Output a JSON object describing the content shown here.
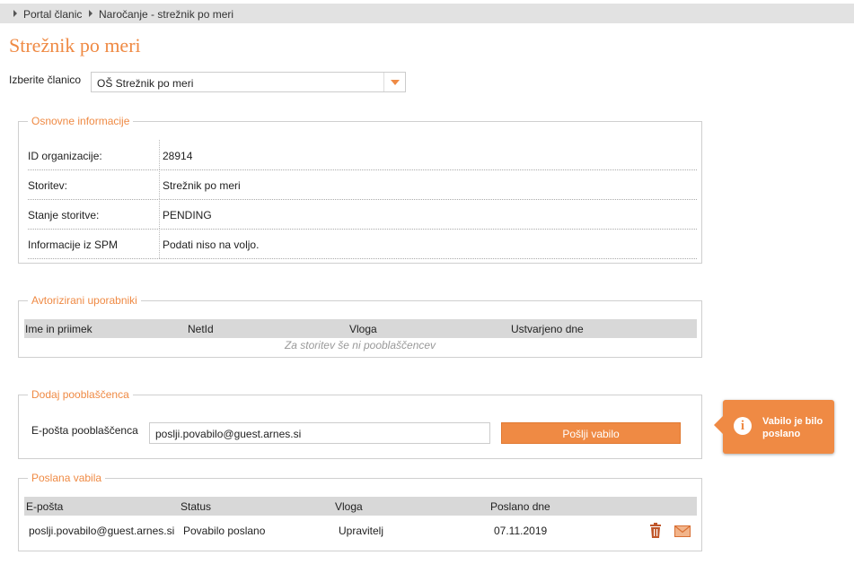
{
  "breadcrumb": [
    "Portal članic",
    "Naročanje - strežnik po meri"
  ],
  "page_title": "Strežnik po meri",
  "member_select": {
    "label": "Izberite članico",
    "value": "OŠ Strežnik po meri"
  },
  "basic_info": {
    "legend": "Osnovne informacije",
    "rows": [
      {
        "key": "ID organizacije:",
        "value": "28914"
      },
      {
        "key": "Storitev:",
        "value": "Strežnik po meri"
      },
      {
        "key": "Stanje storitve:",
        "value": "PENDING"
      },
      {
        "key": "Informacije iz SPM",
        "value": "Podati niso na voljo."
      }
    ]
  },
  "authorized_users": {
    "legend": "Avtorizirani uporabniki",
    "columns": [
      "Ime in priimek",
      "NetId",
      "Vloga",
      "Ustvarjeno dne"
    ],
    "empty_text": "Za storitev še ni pooblaščencev"
  },
  "add_authorized": {
    "legend": "Dodaj pooblaščenca",
    "email_label": "E-pošta pooblaščenca",
    "email_value": "poslji.povabilo@guest.arnes.si",
    "send_label": "Pošlji vabilo"
  },
  "sent_invites": {
    "legend": "Poslana vabila",
    "columns": [
      "E-pošta",
      "Status",
      "Vloga",
      "Poslano dne"
    ],
    "rows": [
      {
        "email": "poslji.povabilo@guest.arnes.si",
        "status": "Povabilo poslano",
        "role": "Upravitelj",
        "date": "07.11.2019"
      }
    ]
  },
  "toast": {
    "message": "Vabilo je bilo poslano",
    "icon": "info-icon"
  },
  "colors": {
    "accent": "#ef8a44",
    "header_bg": "#d8d8d8",
    "crumb_bg": "#e2e2e2"
  }
}
